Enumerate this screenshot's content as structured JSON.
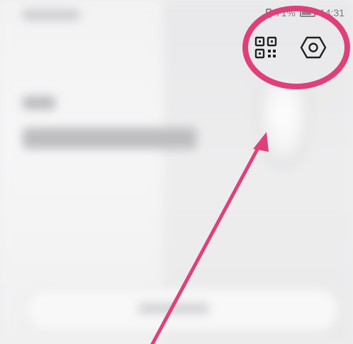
{
  "status_bar": {
    "battery_percent": "71%",
    "time": "14:31",
    "vibrate_icon": "vibrate-icon",
    "battery_icon": "battery-icon"
  },
  "toolbar": {
    "qr_icon": "qr-code-icon",
    "settings_icon": "settings-hexagon-icon"
  },
  "annotation_color": "#e0407a",
  "background_color": "#efeff0"
}
